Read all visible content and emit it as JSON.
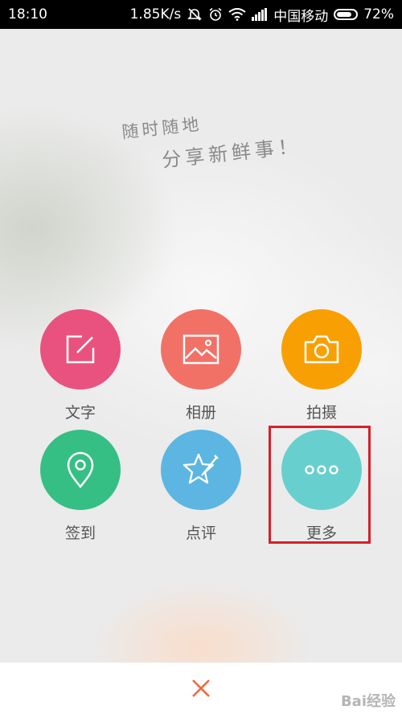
{
  "status_bar": {
    "time": "18:10",
    "speed": "1.85K/s",
    "carrier": "中国移动",
    "battery": "72%"
  },
  "slogan": {
    "line1": "随时随地",
    "line2": "分享新鲜事！"
  },
  "actions": [
    {
      "label": "文字",
      "color": "#e9527e",
      "icon": "edit-icon"
    },
    {
      "label": "相册",
      "color": "#f17166",
      "icon": "picture-icon"
    },
    {
      "label": "拍摄",
      "color": "#f8a003",
      "icon": "camera-icon"
    },
    {
      "label": "签到",
      "color": "#35bf84",
      "icon": "location-pin-icon"
    },
    {
      "label": "点评",
      "color": "#5cb6e1",
      "icon": "star-pen-icon"
    },
    {
      "label": "更多",
      "color": "#68cfcf",
      "icon": "more-dots-icon"
    }
  ],
  "close_icon": "close-icon",
  "close_color": "#f06a3c",
  "watermark": "Bai经验",
  "highlight_color": "#d81f2a"
}
